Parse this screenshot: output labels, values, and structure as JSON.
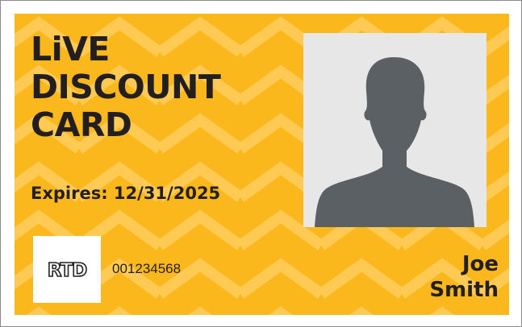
{
  "card": {
    "title_lines": [
      "LiVE",
      "DISCOUNT",
      "CARD"
    ],
    "expires": "Expires: 12/31/2025",
    "logo_text": "RTD",
    "card_number": "001234568",
    "holder": {
      "first_name": "Joe",
      "last_name": "Smith"
    }
  },
  "colors": {
    "card_background": "#fbb81c",
    "pattern": "#ffd066",
    "text": "#231f20",
    "photo_background": "#e7e7e8",
    "silhouette": "#5b6064"
  },
  "icons": {
    "photo": "person-silhouette-icon",
    "logo": "rtd-logo-icon"
  }
}
